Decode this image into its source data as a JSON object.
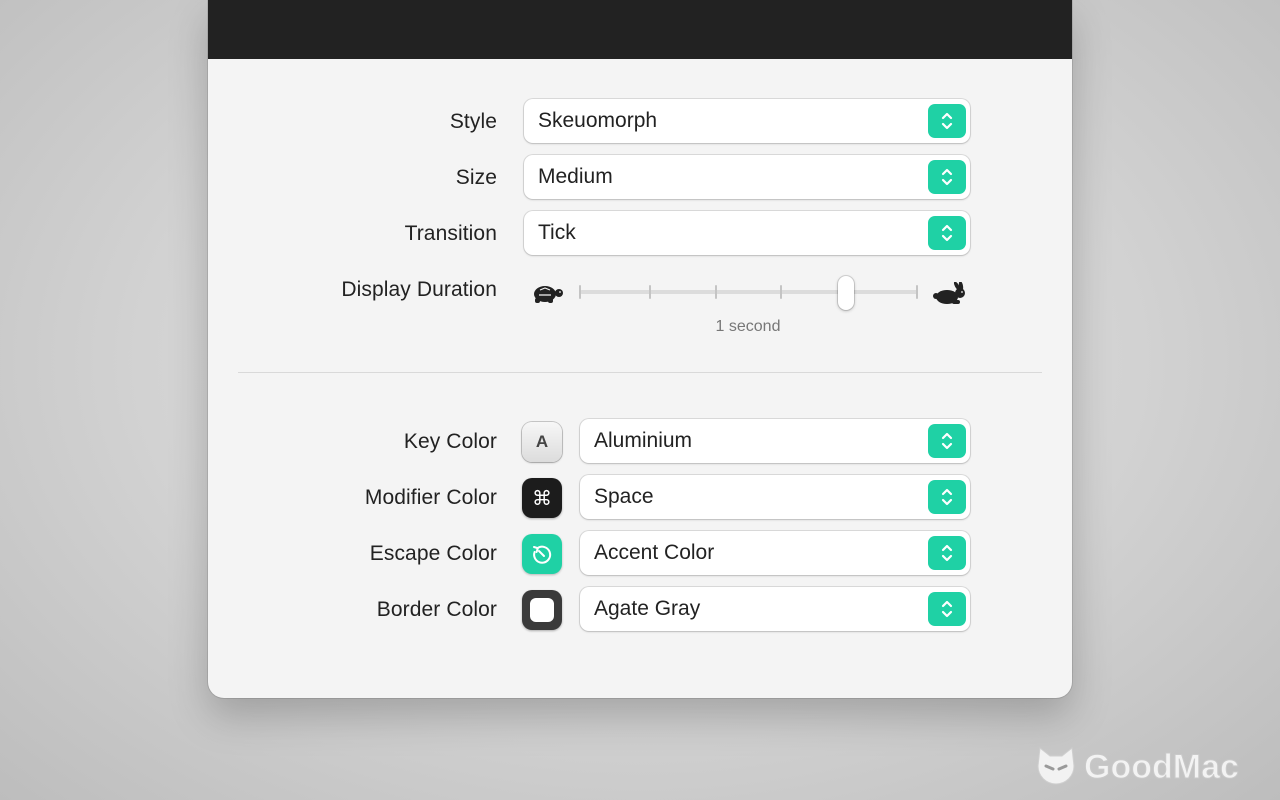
{
  "style": {
    "label": "Style",
    "value": "Skeuomorph"
  },
  "size": {
    "label": "Size",
    "value": "Medium"
  },
  "transition": {
    "label": "Transition",
    "value": "Tick"
  },
  "display_duration": {
    "label": "Display Duration",
    "caption": "1 second",
    "position_index": 4,
    "tick_count": 6,
    "min_icon": "turtle-icon",
    "max_icon": "rabbit-icon"
  },
  "key_color": {
    "label": "Key Color",
    "value": "Aluminium",
    "swatch_glyph": "A"
  },
  "modifier_color": {
    "label": "Modifier Color",
    "value": "Space",
    "swatch_glyph": "⌘"
  },
  "escape_color": {
    "label": "Escape Color",
    "value": "Accent Color",
    "swatch_icon": "escape-arrow-icon"
  },
  "border_color": {
    "label": "Border Color",
    "value": "Agate Gray",
    "swatch_icon": "rounded-square-icon"
  },
  "watermark": {
    "text": "GoodMac"
  },
  "colors": {
    "accent": "#1fd1a5",
    "window_bg": "#f4f4f4",
    "topbar": "#222222",
    "text": "#222222"
  }
}
